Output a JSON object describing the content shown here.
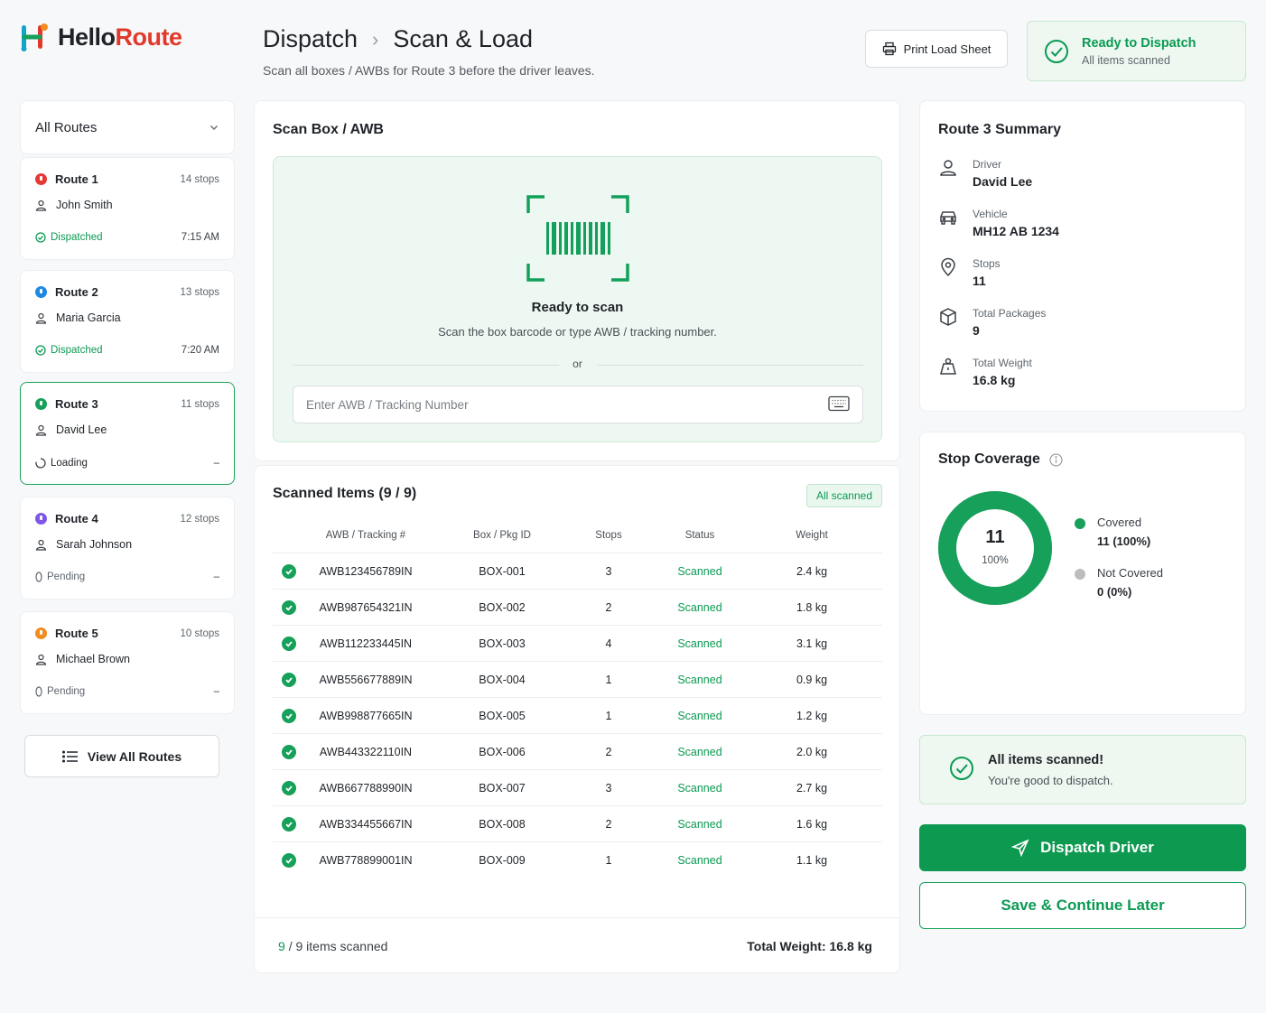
{
  "brand": {
    "hello": "Hello",
    "route": "Route"
  },
  "breadcrumb": {
    "parent": "Dispatch",
    "current": "Scan & Load"
  },
  "subtitle": "Scan all boxes / AWBs for Route 3 before the driver leaves.",
  "header": {
    "print_label": "Print Load Sheet",
    "ready_title": "Ready to Dispatch",
    "ready_sub": "All items scanned"
  },
  "sidebar": {
    "filter_label": "All Routes",
    "routes": [
      {
        "name": "Route 1",
        "stops": "14 stops",
        "driver": "John Smith",
        "status": "Dispatched",
        "time": "7:15 AM",
        "color": "#e53935"
      },
      {
        "name": "Route 2",
        "stops": "13 stops",
        "driver": "Maria Garcia",
        "status": "Dispatched",
        "time": "7:20 AM",
        "color": "#1e88e5"
      },
      {
        "name": "Route 3",
        "stops": "11 stops",
        "driver": "David Lee",
        "status": "Loading",
        "time": "–",
        "color": "#16a05a"
      },
      {
        "name": "Route 4",
        "stops": "12 stops",
        "driver": "Sarah Johnson",
        "status": "Pending",
        "time": "–",
        "color": "#7e57e8"
      },
      {
        "name": "Route 5",
        "stops": "10 stops",
        "driver": "Michael Brown",
        "status": "Pending",
        "time": "–",
        "color": "#f28c1e"
      }
    ],
    "view_all_label": "View All Routes"
  },
  "scan": {
    "title": "Scan Box / AWB",
    "ready_title": "Ready to scan",
    "ready_sub": "Scan the box barcode or type AWB / tracking number.",
    "or": "or",
    "input_placeholder": "Enter AWB / Tracking Number"
  },
  "table": {
    "title": "Scanned Items (9 / 9)",
    "badge": "All scanned",
    "headers": [
      "AWB / Tracking #",
      "Box / Pkg ID",
      "Stops",
      "Status",
      "Weight"
    ],
    "rows": [
      {
        "awb": "AWB123456789IN",
        "box": "BOX-001",
        "stops": "3",
        "status": "Scanned",
        "weight": "2.4 kg"
      },
      {
        "awb": "AWB987654321IN",
        "box": "BOX-002",
        "stops": "2",
        "status": "Scanned",
        "weight": "1.8 kg"
      },
      {
        "awb": "AWB112233445IN",
        "box": "BOX-003",
        "stops": "4",
        "status": "Scanned",
        "weight": "3.1 kg"
      },
      {
        "awb": "AWB556677889IN",
        "box": "BOX-004",
        "stops": "1",
        "status": "Scanned",
        "weight": "0.9 kg"
      },
      {
        "awb": "AWB998877665IN",
        "box": "BOX-005",
        "stops": "1",
        "status": "Scanned",
        "weight": "1.2 kg"
      },
      {
        "awb": "AWB443322110IN",
        "box": "BOX-006",
        "stops": "2",
        "status": "Scanned",
        "weight": "2.0 kg"
      },
      {
        "awb": "AWB667788990IN",
        "box": "BOX-007",
        "stops": "3",
        "status": "Scanned",
        "weight": "2.7 kg"
      },
      {
        "awb": "AWB334455667IN",
        "box": "BOX-008",
        "stops": "2",
        "status": "Scanned",
        "weight": "1.6 kg"
      },
      {
        "awb": "AWB778899001IN",
        "box": "BOX-009",
        "stops": "1",
        "status": "Scanned",
        "weight": "1.1 kg"
      }
    ],
    "footer_count": "9",
    "footer_total": "9",
    "footer_items_label": "items scanned",
    "footer_weight": "Total Weight: 16.8 kg"
  },
  "summary": {
    "title": "Route 3 Summary",
    "driver_label": "Driver",
    "driver": "David Lee",
    "vehicle_label": "Vehicle",
    "vehicle": "MH12 AB 1234",
    "stops_label": "Stops",
    "stops": "11",
    "packages_label": "Total Packages",
    "packages": "9",
    "weight_label": "Total Weight",
    "weight": "16.8 kg"
  },
  "coverage": {
    "title": "Stop Coverage",
    "center_value": "11",
    "center_pct": "100%",
    "covered_fraction": 1.0,
    "covered_label": "Covered",
    "covered_value": "11 (100%)",
    "not_covered_label": "Not Covered",
    "not_covered_value": "0 (0%)"
  },
  "done": {
    "title": "All items scanned!",
    "sub": "You're good to dispatch."
  },
  "actions": {
    "dispatch_label": "Dispatch Driver",
    "save_label": "Save & Continue Later"
  },
  "colors": {
    "accent": "#0d9950",
    "brand_red": "#e0392b",
    "covered": "#16a05a",
    "not_covered": "#bdbdbd"
  }
}
